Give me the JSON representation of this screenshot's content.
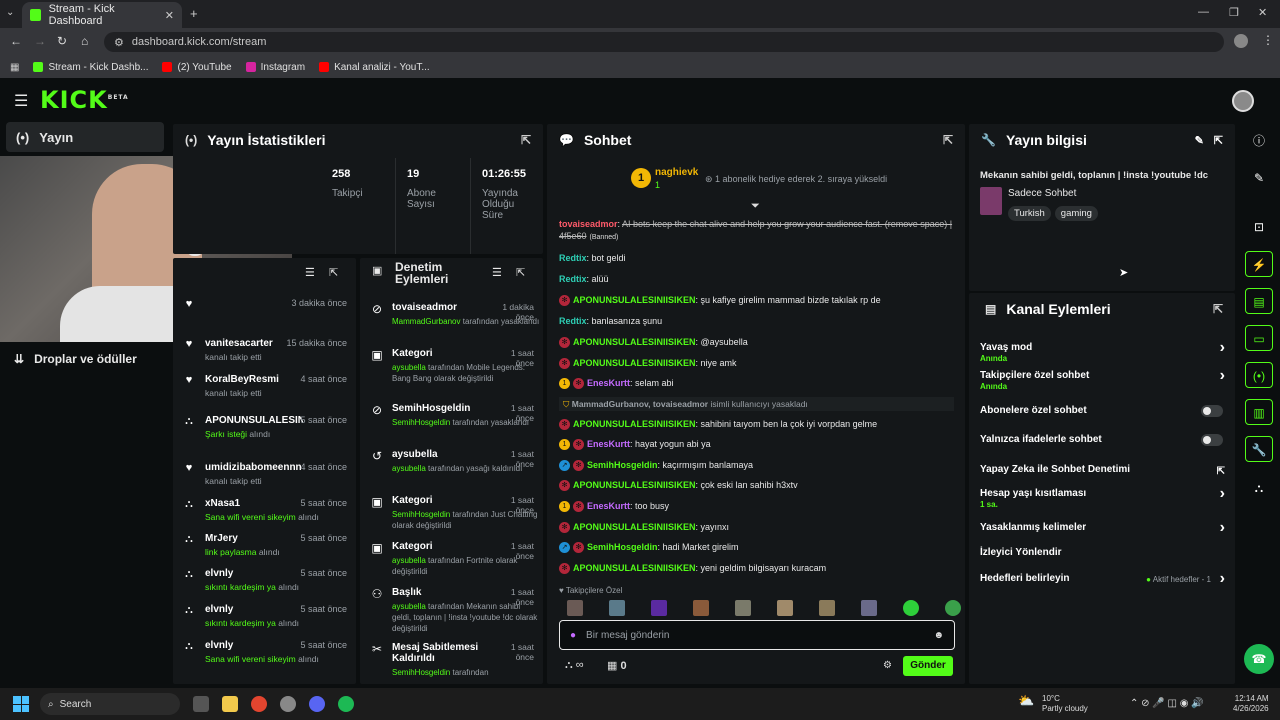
{
  "browser": {
    "tab_title": "Stream - Kick Dashboard",
    "url": "dashboard.kick.com/stream",
    "bookmarks": [
      "Stream - Kick Dashb...",
      "(2) YouTube",
      "Instagram",
      "Kanal analizi - YouT..."
    ]
  },
  "app": {
    "logo": "KICK",
    "logo_sup": "BETA"
  },
  "nav": {
    "active": "Yayın",
    "drops": "Droplar ve ödüller"
  },
  "stats": {
    "title": "Yayın İstatistikleri",
    "items": [
      {
        "value": "258",
        "label": "Takipçi"
      },
      {
        "value": "19",
        "label": "Abone Sayısı"
      },
      {
        "value": "01:26:55",
        "label": "Yayında Olduğu Süre"
      }
    ]
  },
  "activity": {
    "items": [
      {
        "name": "",
        "time": "3 dakika önce",
        "sub": ""
      },
      {
        "name": "vanitesacarter",
        "time": "15 dakika önce",
        "sub": "kanalı takip etti"
      },
      {
        "name": "KoralBeyResmi",
        "time": "4 saat önce",
        "sub": "kanalı takip etti"
      },
      {
        "name": "APONUNSULALESINIISIKEN",
        "time": "5 saat önce",
        "sub_g": "Şarkı isteği",
        "sub": "alındı"
      },
      {
        "name": "umidizibabomeennn",
        "time": "4 saat önce",
        "sub": "kanalı takip etti"
      },
      {
        "name": "xNasa1",
        "time": "5 saat önce",
        "sub_g": "Sana wifi vereni sikeyim",
        "sub": "alındı"
      },
      {
        "name": "MrJery",
        "time": "5 saat önce",
        "sub_g": "link paylasma",
        "sub": "alındı"
      },
      {
        "name": "elvnly",
        "time": "5 saat önce",
        "sub_g": "sıkıntı kardeşim ya",
        "sub": "alındı"
      },
      {
        "name": "elvnly",
        "time": "5 saat önce",
        "sub_g": "sıkıntı kardeşim ya",
        "sub": "alındı"
      },
      {
        "name": "elvnly",
        "time": "5 saat önce",
        "sub_g": "Sana wifi vereni sikeyim",
        "sub": "alındı"
      }
    ]
  },
  "moderation": {
    "title": "Denetim Eylemleri",
    "items": [
      {
        "title": "tovaiseadmor",
        "time": "1 dakika önce",
        "g": "MammadGurbanov",
        "d": "tarafından yasaklandı"
      },
      {
        "title": "Kategori",
        "time": "1 saat önce",
        "g": "aysubella",
        "d": "tarafından Mobile Legends: Bang Bang olarak değiştirildi"
      },
      {
        "title": "SemihHosgeldin",
        "time": "1 saat önce",
        "g": "SemihHosgeldin",
        "d": "tarafından yasaklandı"
      },
      {
        "title": "aysubella",
        "time": "1 saat önce",
        "g": "aysubella",
        "d": "tarafından yasağı kaldırıldı"
      },
      {
        "title": "Kategori",
        "time": "1 saat önce",
        "g": "SemihHosgeldin",
        "d": "tarafından Just Chatting olarak değiştirildi"
      },
      {
        "title": "Kategori",
        "time": "1 saat önce",
        "g": "aysubella",
        "d": "tarafından Fortnite olarak değiştirildi"
      },
      {
        "title": "Başlık",
        "time": "1 saat önce",
        "g": "aysubella",
        "d": "tarafından Mekanın sahibi geldi, toplanın | !insta !youtube !dc olarak değiştirildi"
      },
      {
        "title": "Mesaj Sabitlemesi Kaldırıldı",
        "time": "1 saat önce",
        "g": "SemihHosgeldin",
        "d": "tarafından"
      }
    ]
  },
  "chat": {
    "title": "Sohbet",
    "gift_user": "naghievk",
    "gift_count": "1",
    "gift_text": "1 abonelik hediye ederek 2. sıraya yükseldi",
    "messages": [
      {
        "user": "tovaiseadmor",
        "text": "AI bots keep the chat alive and help you grow your audience fast. (remove space) | 4f5e60",
        "extra": "(Banned)"
      },
      {
        "user": "Redtix",
        "text": "bot geldi"
      },
      {
        "user": "Redtix",
        "text": "alüü"
      },
      {
        "user": "APONUNSULALESINIISIKEN",
        "text": "şu kafiye girelim mammad bizde takılak rp de"
      },
      {
        "user": "Redtix",
        "text": "banlasanıza şunu"
      },
      {
        "user": "APONUNSULALESINIISIKEN",
        "text": "@aysubella"
      },
      {
        "user": "APONUNSULALESINIISIKEN",
        "text": "niye amk"
      },
      {
        "user": "EnesKurtt",
        "text": "selam abi"
      },
      {
        "user": "MammadGurbanov, tovaiseadmor",
        "text": "isimli kullanıcıyı yasakladı"
      },
      {
        "user": "APONUNSULALESINIISIKEN",
        "text": "sahibini taıyom ben la çok iyi vorpdan gelme"
      },
      {
        "user": "EnesKurtt",
        "text": "hayat yogun abi ya"
      },
      {
        "user": "SemihHosgeldin",
        "text": "kaçırmışım banlamaya"
      },
      {
        "user": "APONUNSULALESINIISIKEN",
        "text": "çok eski lan sahibi h3xtv"
      },
      {
        "user": "EnesKurtt",
        "text": "too busy"
      },
      {
        "user": "APONUNSULALESINIISIKEN",
        "text": "yayınxı"
      },
      {
        "user": "SemihHosgeldin",
        "text": "hadi Market girelim"
      },
      {
        "user": "APONUNSULALESINIISIKEN",
        "text": "yeni geldim bilgisayarı kuracam"
      }
    ],
    "followers_label": "Takipçilere Özel",
    "input_placeholder": "Bir mesaj gönderin",
    "points": "0",
    "send": "Gönder"
  },
  "info": {
    "title": "Yayın bilgisi",
    "stream_title": "Mekanın sahibi geldi, toplanın | !insta !youtube !dc",
    "category": "Sadece Sohbet",
    "tags": [
      "Turkish",
      "gaming"
    ]
  },
  "actions": {
    "title": "Kanal Eylemleri",
    "items": [
      {
        "label": "Yavaş mod",
        "sub": "Anında"
      },
      {
        "label": "Takipçilere özel sohbet",
        "sub": "Anında"
      },
      {
        "label": "Abonelere özel sohbet",
        "sub": ""
      },
      {
        "label": "Yalnızca ifadelerle sohbet",
        "sub": ""
      },
      {
        "label": "Yapay Zeka ile Sohbet Denetimi",
        "sub": ""
      },
      {
        "label": "Hesap yaşı kısıtlaması",
        "sub": "1 sa."
      },
      {
        "label": "Yasaklanmış kelimeler",
        "sub": ""
      },
      {
        "label": "İzleyici Yönlendir",
        "sub": ""
      },
      {
        "label": "Hedefleri belirleyin",
        "sub": "",
        "right": "Aktif hedefler - 1"
      }
    ]
  },
  "taskbar": {
    "search": "Search",
    "weather_temp": "10°C",
    "weather_desc": "Partly cloudy",
    "time": "12:14 AM",
    "date": "4/26/2026"
  },
  "colors": {
    "accent": "#53fc18",
    "panel": "#141719",
    "bg": "#0b0e0f"
  }
}
